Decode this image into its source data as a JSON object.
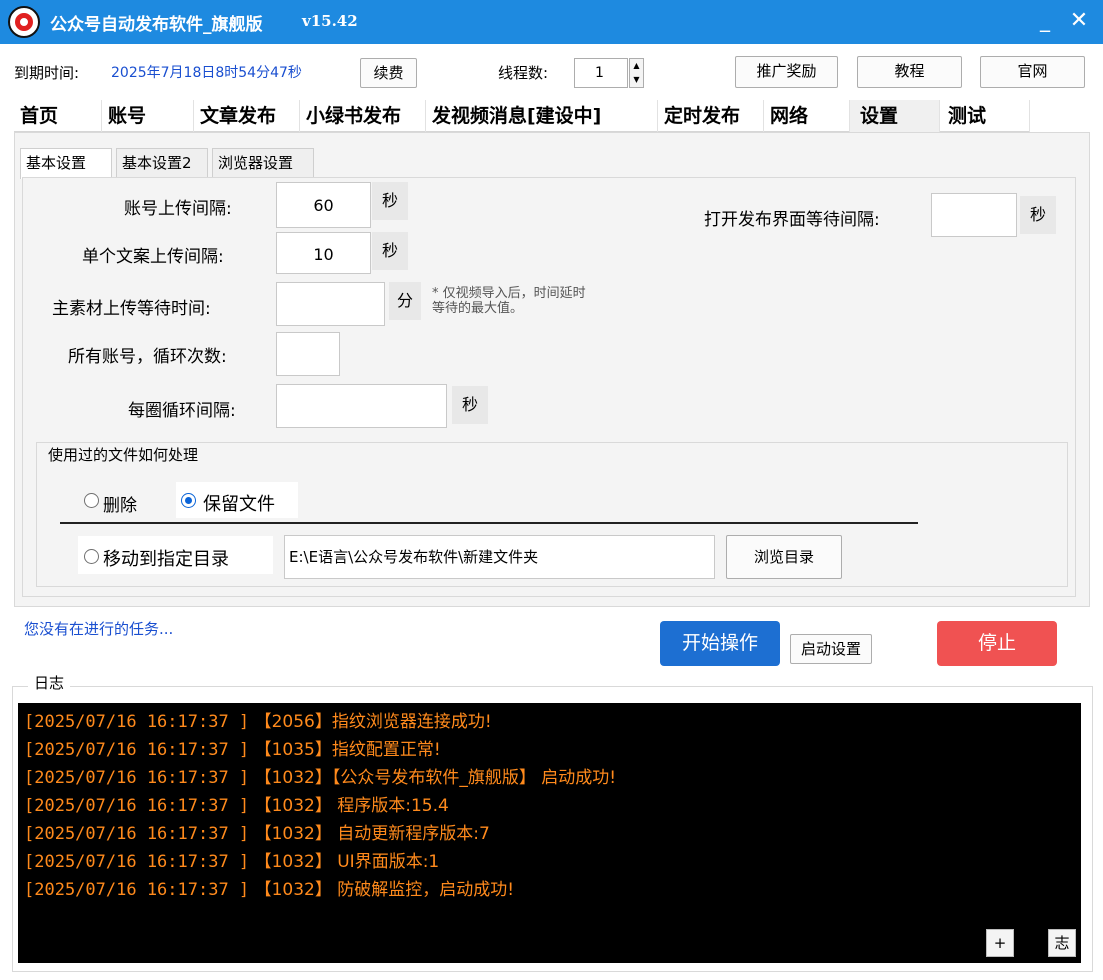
{
  "window": {
    "title": "公众号自动发布软件_旗舰版",
    "version": "v15.42",
    "minimize": "_",
    "close": "✕"
  },
  "header": {
    "expiry_label": "到期时间:",
    "expiry_value": "2025年7月18日8时54分47秒",
    "renew_label": "续费",
    "threads_label": "线程数:",
    "threads_value": "1",
    "promo_label": "推广奖励",
    "tutorial_label": "教程",
    "website_label": "官网"
  },
  "tabs": [
    "首页",
    "账号",
    "文章发布",
    "小绿书发布",
    "发视频消息[建设中]",
    "定时发布",
    "网络",
    "设置",
    "测试"
  ],
  "active_tab": "设置",
  "subtabs": [
    "基本设置",
    "基本设置2",
    "浏览器设置"
  ],
  "settings": {
    "account_upload_interval_label": "账号上传间隔:",
    "account_upload_interval_value": "60",
    "account_upload_interval_unit": "秒",
    "single_copy_interval_label": "单个文案上传间隔:",
    "single_copy_interval_value": "10",
    "single_copy_interval_unit": "秒",
    "main_material_wait_label": "主素材上传等待时间:",
    "main_material_wait_value": "",
    "main_material_wait_unit": "分",
    "main_material_note_line1": "* 仅视频导入后，时间延时",
    "main_material_note_line2": "等待的最大值。",
    "loop_count_label": "所有账号，循环次数:",
    "loop_count_value": "",
    "loop_interval_label": "每圈循环间隔:",
    "loop_interval_value": "",
    "loop_interval_unit": "秒",
    "open_publish_wait_label": "打开发布界面等待间隔:",
    "open_publish_wait_value": "",
    "open_publish_wait_unit": "秒"
  },
  "file_handling": {
    "group_title": "使用过的文件如何处理",
    "delete_label": "删除",
    "keep_label": "保留文件",
    "move_label": "移动到指定目录",
    "path_value": "E:\\E语言\\公众号发布软件\\新建文件夹",
    "browse_label": "浏览目录",
    "selected": "keep"
  },
  "status": {
    "text": "您没有在进行的任务...",
    "start_label": "开始操作",
    "startup_settings_label": "启动设置",
    "stop_label": "停止"
  },
  "log": {
    "title": "日志",
    "lines": [
      {
        "time": "[2025/07/16 16:17:37 ]",
        "msg": " 【2056】指纹浏览器连接成功!"
      },
      {
        "time": "[2025/07/16 16:17:37 ]",
        "msg": " 【1035】指纹配置正常!"
      },
      {
        "time": "[2025/07/16 16:17:37 ]",
        "msg": " 【1032】【公众号发布软件_旗舰版】 启动成功!"
      },
      {
        "time": "[2025/07/16 16:17:37 ]",
        "msg": " 【1032】 程序版本:15.4"
      },
      {
        "time": "[2025/07/16 16:17:37 ]",
        "msg": " 【1032】 自动更新程序版本:7"
      },
      {
        "time": "[2025/07/16 16:17:37 ]",
        "msg": " 【1032】 UI界面版本:1"
      },
      {
        "time": "[2025/07/16 16:17:37 ]",
        "msg": " 【1032】 防破解监控，启动成功!"
      }
    ],
    "plus_label": "+",
    "log_short_label": "志"
  },
  "colors": {
    "titlebar": "#1e8ae0",
    "start_button": "#1d6fd2",
    "stop_button": "#f05252",
    "log_text": "#ff8a1c",
    "status_text": "#1a4fd0"
  }
}
